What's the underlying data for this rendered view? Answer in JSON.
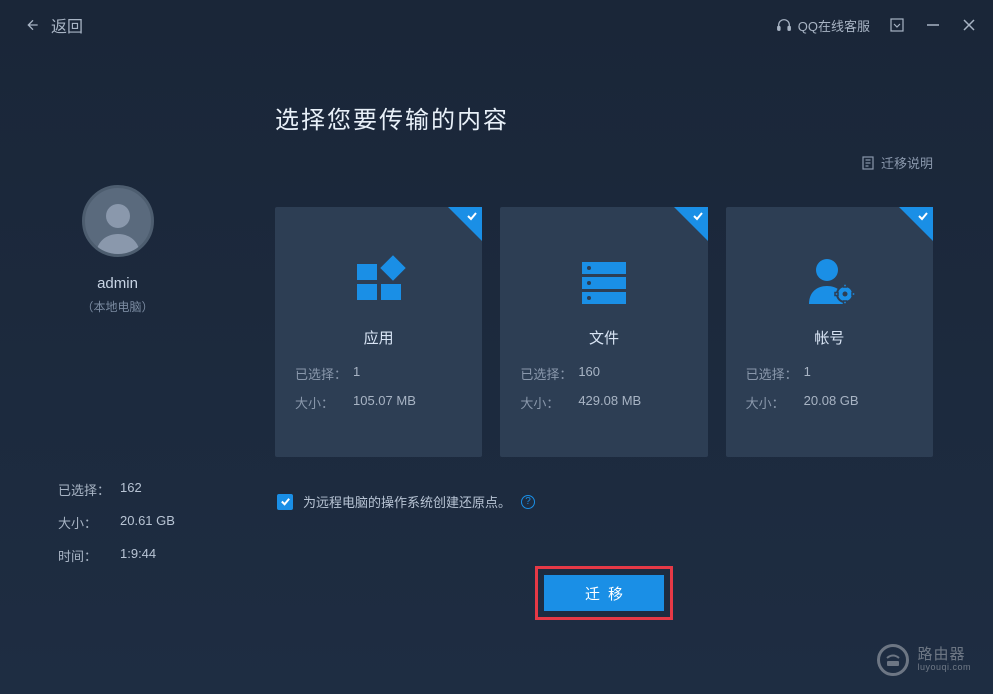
{
  "titlebar": {
    "back_label": "返回",
    "support_label": "QQ在线客服"
  },
  "sidebar": {
    "username": "admin",
    "subtitle": "（本地电脑）",
    "stats": {
      "selected_label": "已选择：",
      "selected_value": "162",
      "size_label": "大小：",
      "size_value": "20.61 GB",
      "time_label": "时间：",
      "time_value": "1:9:44"
    }
  },
  "content": {
    "title": "选择您要传输的内容",
    "help_label": "迁移说明",
    "cards": [
      {
        "title": "应用",
        "selected_label": "已选择：",
        "selected_value": "1",
        "size_label": "大小：",
        "size_value": "105.07 MB"
      },
      {
        "title": "文件",
        "selected_label": "已选择：",
        "selected_value": "160",
        "size_label": "大小：",
        "size_value": "429.08 MB"
      },
      {
        "title": "帐号",
        "selected_label": "已选择：",
        "selected_value": "1",
        "size_label": "大小：",
        "size_value": "20.08 GB"
      }
    ],
    "checkbox_label": "为远程电脑的操作系统创建还原点。",
    "action_label": "迁移"
  },
  "watermark": {
    "cn": "路由器",
    "en": "luyouqi.com"
  }
}
